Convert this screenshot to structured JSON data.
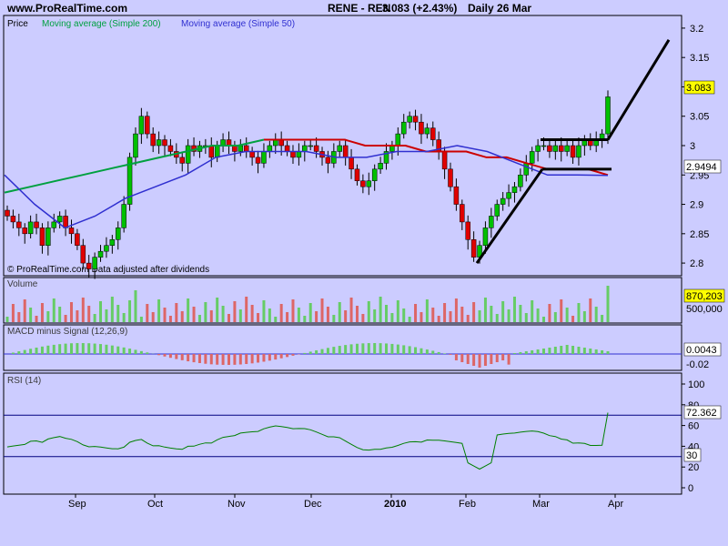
{
  "header": {
    "site": "www.ProRealTime.com",
    "ticker": "RENE - REN",
    "price_change": "3.083 (+2.43%)",
    "period_date": "Daily  26 Mar"
  },
  "price_panel": {
    "legend": [
      {
        "label": "Price",
        "color": "#000000"
      },
      {
        "label": "Moving average (Simple 200)",
        "color": "#00a040"
      },
      {
        "label": "Moving average (Simple 50)",
        "color": "#3030d0"
      }
    ],
    "copyright": "© ProRealTime.com  Data adjusted after dividends",
    "last_price_label": "3.083",
    "ma_label": "2.9494",
    "up_color": "#00c000",
    "down_color": "#e00000",
    "ma200_color": "#00a040",
    "ma50_color": "#3030d0",
    "ma200_after_cross_color": "#cc0000"
  },
  "volume_panel": {
    "title": "Volume",
    "last_label": "870,203",
    "tick_label": "500,000"
  },
  "macd_panel": {
    "title": "MACD minus Signal (12,26,9)",
    "last_label": "0.0043",
    "tick_label": "-0.02"
  },
  "rsi_panel": {
    "title": "RSI (14)",
    "last_label": "72.362",
    "level_label": "30",
    "ticks": [
      "100",
      "80",
      "60",
      "40",
      "20",
      "0"
    ]
  },
  "x_axis": {
    "labels": [
      "Sep",
      "Oct",
      "Nov",
      "Dec",
      "2010",
      "Feb",
      "Mar",
      "Apr"
    ]
  },
  "chart_data": [
    {
      "type": "candlestick",
      "title": "RENE - REN",
      "y_ticks": [
        3.2,
        3.15,
        3.1,
        3.05,
        3.0,
        2.95,
        2.9,
        2.85,
        2.8
      ],
      "ylim": [
        2.78,
        3.22
      ],
      "x_dates": [
        "Sep",
        "Oct",
        "Nov",
        "Dec",
        "2010",
        "Feb",
        "Mar",
        "Apr"
      ],
      "close": [
        2.88,
        2.87,
        2.86,
        2.85,
        2.87,
        2.86,
        2.83,
        2.86,
        2.87,
        2.88,
        2.86,
        2.85,
        2.83,
        2.8,
        2.79,
        2.81,
        2.82,
        2.83,
        2.84,
        2.86,
        2.9,
        2.98,
        3.02,
        3.05,
        3.02,
        3.0,
        3.01,
        3.0,
        2.99,
        2.98,
        2.97,
        3.0,
        2.99,
        3.0,
        3.0,
        2.98,
        3.0,
        3.01,
        3.0,
        2.99,
        3.0,
        2.99,
        2.98,
        2.97,
        2.99,
        3.0,
        3.01,
        3.0,
        2.99,
        2.98,
        2.99,
        3.0,
        3.0,
        2.99,
        2.98,
        2.97,
        2.99,
        3.0,
        2.98,
        2.96,
        2.94,
        2.93,
        2.94,
        2.96,
        2.97,
        2.99,
        3.0,
        3.02,
        3.04,
        3.05,
        3.04,
        3.02,
        3.03,
        3.01,
        2.99,
        2.96,
        2.93,
        2.9,
        2.87,
        2.84,
        2.81,
        2.83,
        2.86,
        2.88,
        2.9,
        2.91,
        2.92,
        2.93,
        2.95,
        2.97,
        2.99,
        3.0,
        3.0,
        2.99,
        3.0,
        2.99,
        3.0,
        2.98,
        3.0,
        3.01,
        3.0,
        3.01,
        3.02,
        3.083
      ],
      "series": [
        {
          "name": "Moving average (Simple 200)",
          "values": [
            2.92,
            2.93,
            2.94,
            2.95,
            2.96,
            2.97,
            2.98,
            2.99,
            3.0,
            3.0,
            3.01,
            3.01,
            3.01,
            3.01,
            3.01,
            3.0,
            3.0,
            3.0,
            2.99,
            2.99,
            2.99,
            2.98,
            2.98,
            2.97,
            2.96,
            2.96,
            2.96,
            2.95
          ]
        },
        {
          "name": "Moving average (Simple 50)",
          "values": [
            2.95,
            2.9,
            2.86,
            2.88,
            2.91,
            2.93,
            2.95,
            2.98,
            2.99,
            2.99,
            2.99,
            2.98,
            2.98,
            2.99,
            2.99,
            3.0,
            2.99,
            2.97,
            2.95,
            2.95,
            2.9494
          ]
        }
      ],
      "annotations": [
        "uptrend line Feb–Mar",
        "resistance line ~3.01",
        "support line ~2.96",
        "projection line to ~3.18 in Apr"
      ]
    },
    {
      "type": "bar",
      "title": "Volume",
      "last_value": 870203,
      "y_ticks": [
        500000
      ]
    },
    {
      "type": "bar",
      "title": "MACD minus Signal (12,26,9)",
      "last_value": 0.0043,
      "y_ticks": [
        -0.02
      ]
    },
    {
      "type": "line",
      "title": "RSI (14)",
      "last_value": 72.362,
      "ylim": [
        0,
        100
      ],
      "y_ticks": [
        100,
        80,
        60,
        40,
        20,
        0
      ],
      "reference_lines": [
        70,
        30
      ]
    }
  ]
}
